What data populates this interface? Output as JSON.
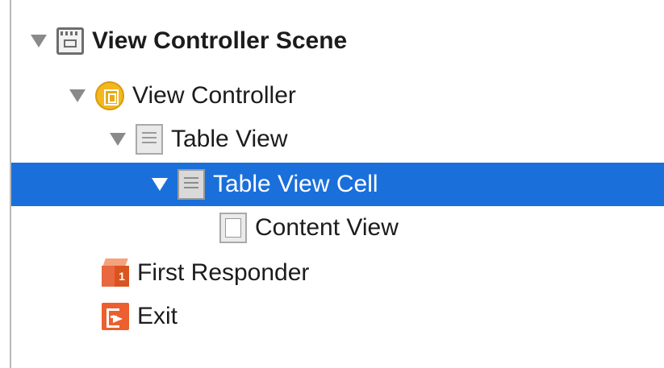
{
  "outline": {
    "items": [
      {
        "label": "View Controller Scene",
        "icon": "scene-icon",
        "expanded": true,
        "selected": false,
        "bold": true
      },
      {
        "label": "View Controller",
        "icon": "view-controller-icon",
        "expanded": true,
        "selected": false,
        "bold": false
      },
      {
        "label": "Table View",
        "icon": "table-view-icon",
        "expanded": true,
        "selected": false,
        "bold": false
      },
      {
        "label": "Table View Cell",
        "icon": "table-view-cell-icon",
        "expanded": true,
        "selected": true,
        "bold": false
      },
      {
        "label": "Content View",
        "icon": "content-view-icon",
        "expanded": false,
        "selected": false,
        "bold": false
      },
      {
        "label": "First Responder",
        "icon": "first-responder-icon",
        "expanded": false,
        "selected": false,
        "bold": false
      },
      {
        "label": "Exit",
        "icon": "exit-icon",
        "expanded": false,
        "selected": false,
        "bold": false
      }
    ],
    "responder_badge": "1"
  },
  "colors": {
    "selection": "#1a6fdb",
    "view_controller": "#f3b81f",
    "first_responder": "#d9541f",
    "exit": "#ec5f2e"
  }
}
